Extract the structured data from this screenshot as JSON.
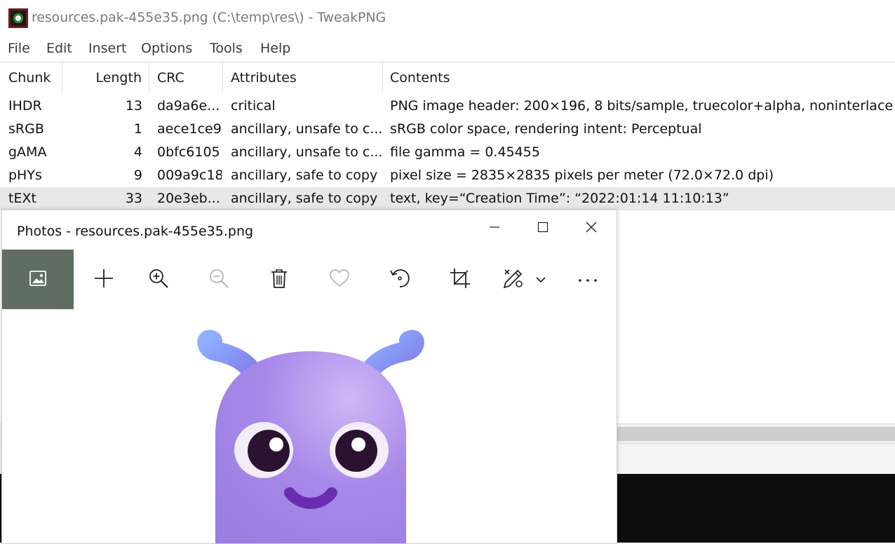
{
  "tweakpng": {
    "title": "resources.pak-455e35.png (C:\\temp\\res\\) - TweakPNG",
    "menu": [
      "File",
      "Edit",
      "Insert",
      "Options",
      "Tools",
      "Help"
    ],
    "columns": [
      "Chunk",
      "Length",
      "CRC",
      "Attributes",
      "Contents"
    ],
    "rows": [
      {
        "chunk": "IHDR",
        "length": "13",
        "crc": "da9a6e...",
        "attributes": "critical",
        "contents": "PNG image header: 200×196, 8 bits/sample, truecolor+alpha, noninterlaced"
      },
      {
        "chunk": "sRGB",
        "length": "1",
        "crc": "aece1ce9",
        "attributes": "ancillary, unsafe to c...",
        "contents": "sRGB color space, rendering intent: Perceptual"
      },
      {
        "chunk": "gAMA",
        "length": "4",
        "crc": "0bfc6105",
        "attributes": "ancillary, unsafe to c...",
        "contents": "file gamma = 0.45455"
      },
      {
        "chunk": "pHYs",
        "length": "9",
        "crc": "009a9c18",
        "attributes": "ancillary, safe to copy",
        "contents": "pixel size = 2835×2835 pixels per meter (72.0×72.0 dpi)"
      },
      {
        "chunk": "tEXt",
        "length": "33",
        "crc": "20e3eb...",
        "attributes": "ancillary, safe to copy",
        "contents": "text, key=“Creation Time”: “2022:01:14 11:10:13”"
      }
    ],
    "selected_row": 4
  },
  "photos": {
    "title": "Photos - resources.pak-455e35.png",
    "toolbar_icons": [
      "view-image-icon",
      "add-icon",
      "zoom-in-icon",
      "zoom-out-icon",
      "delete-icon",
      "favorite-icon",
      "rotate-icon",
      "crop-icon",
      "edit-draw-icon",
      "more-icon"
    ],
    "accent": "#5f6e60"
  }
}
